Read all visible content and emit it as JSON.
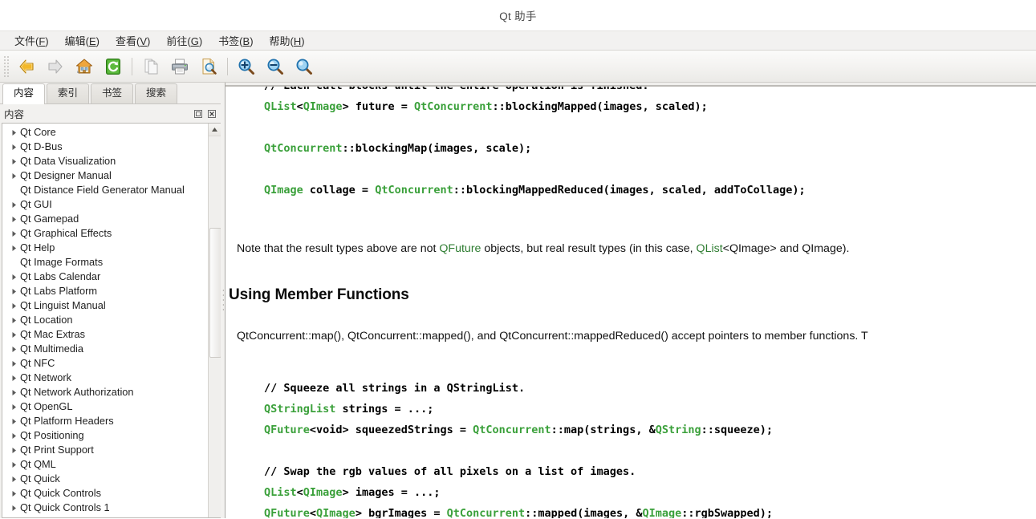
{
  "window": {
    "title": "Qt 助手"
  },
  "menubar": {
    "items": [
      {
        "label": "文件",
        "mnemonic": "F"
      },
      {
        "label": "编辑",
        "mnemonic": "E"
      },
      {
        "label": "查看",
        "mnemonic": "V"
      },
      {
        "label": "前往",
        "mnemonic": "G"
      },
      {
        "label": "书签",
        "mnemonic": "B"
      },
      {
        "label": "帮助",
        "mnemonic": "H"
      }
    ]
  },
  "toolbar": {
    "buttons": [
      {
        "icon": "back-arrow-icon",
        "name": "back-button",
        "enabled": true
      },
      {
        "icon": "forward-arrow-icon",
        "name": "forward-button",
        "enabled": false
      },
      {
        "icon": "home-icon",
        "name": "home-button",
        "enabled": true
      },
      {
        "icon": "reload-icon",
        "name": "reload-button",
        "enabled": true
      },
      {
        "icon": "copy-pages-icon",
        "name": "copy-button",
        "enabled": false
      },
      {
        "icon": "printer-icon",
        "name": "print-button",
        "enabled": true
      },
      {
        "icon": "print-preview-icon",
        "name": "print-preview-button",
        "enabled": true
      },
      {
        "icon": "zoom-in-icon",
        "name": "zoom-in-button",
        "enabled": true
      },
      {
        "icon": "zoom-out-icon",
        "name": "zoom-out-button",
        "enabled": true
      },
      {
        "icon": "zoom-reset-icon",
        "name": "zoom-reset-button",
        "enabled": true
      }
    ]
  },
  "sidebar": {
    "tabs": [
      {
        "label": "内容",
        "active": true
      },
      {
        "label": "索引",
        "active": false
      },
      {
        "label": "书签",
        "active": false
      },
      {
        "label": "搜索",
        "active": false
      }
    ],
    "dock_title": "内容",
    "dock_buttons": [
      {
        "name": "float-dock-button",
        "icon": "float-icon"
      },
      {
        "name": "close-dock-button",
        "icon": "close-icon"
      }
    ],
    "tree_items": [
      {
        "label": "Qt Core",
        "expandable": true
      },
      {
        "label": "Qt D-Bus",
        "expandable": true
      },
      {
        "label": "Qt Data Visualization",
        "expandable": true
      },
      {
        "label": "Qt Designer Manual",
        "expandable": true
      },
      {
        "label": "Qt Distance Field Generator Manual",
        "expandable": false
      },
      {
        "label": "Qt GUI",
        "expandable": true
      },
      {
        "label": "Qt Gamepad",
        "expandable": true
      },
      {
        "label": "Qt Graphical Effects",
        "expandable": true
      },
      {
        "label": "Qt Help",
        "expandable": true
      },
      {
        "label": "Qt Image Formats",
        "expandable": false
      },
      {
        "label": "Qt Labs Calendar",
        "expandable": true
      },
      {
        "label": "Qt Labs Platform",
        "expandable": true
      },
      {
        "label": "Qt Linguist Manual",
        "expandable": true
      },
      {
        "label": "Qt Location",
        "expandable": true
      },
      {
        "label": "Qt Mac Extras",
        "expandable": true
      },
      {
        "label": "Qt Multimedia",
        "expandable": true
      },
      {
        "label": "Qt NFC",
        "expandable": true
      },
      {
        "label": "Qt Network",
        "expandable": true
      },
      {
        "label": "Qt Network Authorization",
        "expandable": true
      },
      {
        "label": "Qt OpenGL",
        "expandable": true
      },
      {
        "label": "Qt Platform Headers",
        "expandable": true
      },
      {
        "label": "Qt Positioning",
        "expandable": true
      },
      {
        "label": "Qt Print Support",
        "expandable": true
      },
      {
        "label": "Qt QML",
        "expandable": true
      },
      {
        "label": "Qt Quick",
        "expandable": true
      },
      {
        "label": "Qt Quick Controls",
        "expandable": true
      },
      {
        "label": "Qt Quick Controls 1",
        "expandable": true
      }
    ]
  },
  "document": {
    "code_block_1": [
      {
        "text": "// Each call blocks until the entire operation is finished.",
        "style": "comment",
        "clipped_top": true
      },
      {
        "text": "QList<QImage> future = QtConcurrent::blockingMapped(images, scaled);",
        "style": "code"
      },
      {
        "text": "",
        "style": "blank"
      },
      {
        "text": "QtConcurrent::blockingMap(images, scale);",
        "style": "code"
      },
      {
        "text": "",
        "style": "blank"
      },
      {
        "text": "QImage collage = QtConcurrent::blockingMappedReduced(images, scaled, addToCollage);",
        "style": "code"
      }
    ],
    "paragraph_1": {
      "before": "Note that the result types above are not ",
      "link1": "QFuture",
      "middle": " objects, but real result types (in this case, ",
      "link2": "QList",
      "after": "<QImage> and QImage)."
    },
    "heading_1": "Using Member Functions",
    "paragraph_2": "QtConcurrent::map(), QtConcurrent::mapped(), and QtConcurrent::mappedReduced() accept pointers to member functions. T",
    "code_block_2": [
      {
        "text": "// Squeeze all strings in a QStringList.",
        "style": "comment"
      },
      {
        "text": "QStringList strings = ...;",
        "style": "code"
      },
      {
        "text": "QFuture<void> squeezedStrings = QtConcurrent::map(strings, &QString::squeeze);",
        "style": "code"
      },
      {
        "text": "",
        "style": "blank"
      },
      {
        "text": "// Swap the rgb values of all pixels on a list of images.",
        "style": "comment"
      },
      {
        "text": "QList<QImage> images = ...;",
        "style": "code"
      },
      {
        "text": "QFuture<QImage> bgrImages = QtConcurrent::mapped(images, &QImage::rgbSwapped);",
        "style": "code"
      }
    ]
  },
  "colors": {
    "code_type_green": "#3aa03a",
    "link_green": "#2f7d32",
    "text_black": "#121212",
    "chrome_gray": "#f2f1ef",
    "tree_bg": "#ffffff"
  }
}
